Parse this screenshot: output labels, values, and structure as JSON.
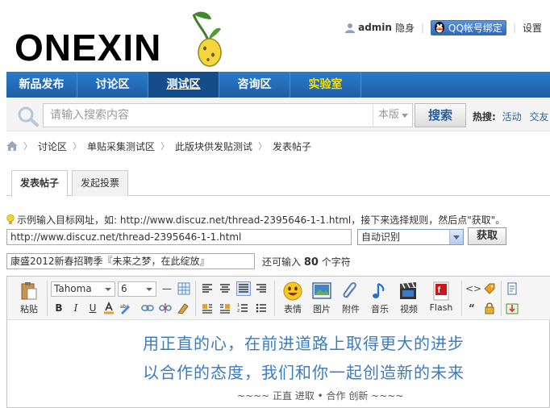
{
  "brand": {
    "logo_text": "ONEXIN"
  },
  "userbar": {
    "username": "admin",
    "status": "隐身",
    "qq_bind": "QQ帐号绑定",
    "settings": "设置"
  },
  "nav": {
    "items": [
      {
        "label": "新品发布"
      },
      {
        "label": "讨论区"
      },
      {
        "label": "测试区"
      },
      {
        "label": "咨询区"
      },
      {
        "label": "实验室"
      }
    ]
  },
  "search": {
    "placeholder": "请输入搜索内容",
    "scope": "本版",
    "button": "搜索",
    "hot_label": "热搜:",
    "hot_links": [
      "活动",
      "交友"
    ]
  },
  "breadcrumb": [
    "讨论区",
    "单贴采集测试区",
    "此版块供发贴测试",
    "发表帖子"
  ],
  "tabs": [
    {
      "label": "发表帖子"
    },
    {
      "label": "发起投票"
    }
  ],
  "form": {
    "hint": "示例输入目标网址，如: http://www.discuz.net/thread-2395646-1-1.html，接下来选择规则，然后点\"获取\"。",
    "url_value": "http://www.discuz.net/thread-2395646-1-1.html",
    "rule_value": "自动识别",
    "fetch_button": "获取",
    "title_value": "康盛2012新春招聘季『未来之梦，在此绽放』",
    "remain_prefix": "还可输入",
    "remain_count": "80",
    "remain_suffix": "个字符"
  },
  "editor": {
    "paste_label": "粘贴",
    "font_family": "Tahoma",
    "font_size": "6",
    "emoji_label": "表情",
    "image_label": "图片",
    "attach_label": "附件",
    "music_label": "音乐",
    "video_label": "视频",
    "flash_label": "Flash",
    "content_line1": "用正直的心，在前进道路上取得更大的进步",
    "content_line2": "以合作的态度，我们和你一起创造新的未来",
    "content_motto": "~~~~ 正直  进取  • 合作  创新  ~~~~"
  },
  "colors": {
    "nav_bg": "#1d5fa6",
    "nav_active": "#144d8a",
    "lab_text": "#ffde00",
    "content_text": "#3b7cc4"
  }
}
